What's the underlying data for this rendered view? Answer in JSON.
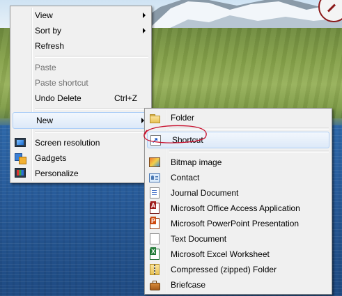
{
  "context_menu": {
    "items": [
      {
        "label": "View",
        "has_submenu": true
      },
      {
        "label": "Sort by",
        "has_submenu": true
      },
      {
        "label": "Refresh"
      },
      {
        "label": "Paste",
        "disabled": true
      },
      {
        "label": "Paste shortcut",
        "disabled": true
      },
      {
        "label": "Undo Delete",
        "shortcut": "Ctrl+Z"
      },
      {
        "label": "New",
        "has_submenu": true,
        "highlighted": true
      },
      {
        "label": "Screen resolution",
        "icon": "monitor-icon"
      },
      {
        "label": "Gadgets",
        "icon": "gadgets-icon"
      },
      {
        "label": "Personalize",
        "icon": "personalize-icon"
      }
    ]
  },
  "new_submenu": {
    "items": [
      {
        "label": "Folder",
        "icon": "folder-icon"
      },
      {
        "label": "Shortcut",
        "icon": "shortcut-icon",
        "highlighted": true,
        "annotated": true
      },
      {
        "label": "Bitmap image",
        "icon": "bitmap-icon"
      },
      {
        "label": "Contact",
        "icon": "contact-icon"
      },
      {
        "label": "Journal Document",
        "icon": "journal-icon"
      },
      {
        "label": "Microsoft Office Access Application",
        "icon": "access-icon"
      },
      {
        "label": "Microsoft PowerPoint Presentation",
        "icon": "powerpoint-icon"
      },
      {
        "label": "Text Document",
        "icon": "text-document-icon"
      },
      {
        "label": "Microsoft Excel Worksheet",
        "icon": "excel-icon"
      },
      {
        "label": "Compressed (zipped) Folder",
        "icon": "zip-folder-icon"
      },
      {
        "label": "Briefcase",
        "icon": "briefcase-icon"
      }
    ]
  },
  "colors": {
    "menu_background": "#f0f0f0",
    "highlight": "#dde9f8",
    "highlight_border": "#aecff7",
    "disabled_text": "#6d6d6d",
    "annotation": "#c8102e"
  }
}
